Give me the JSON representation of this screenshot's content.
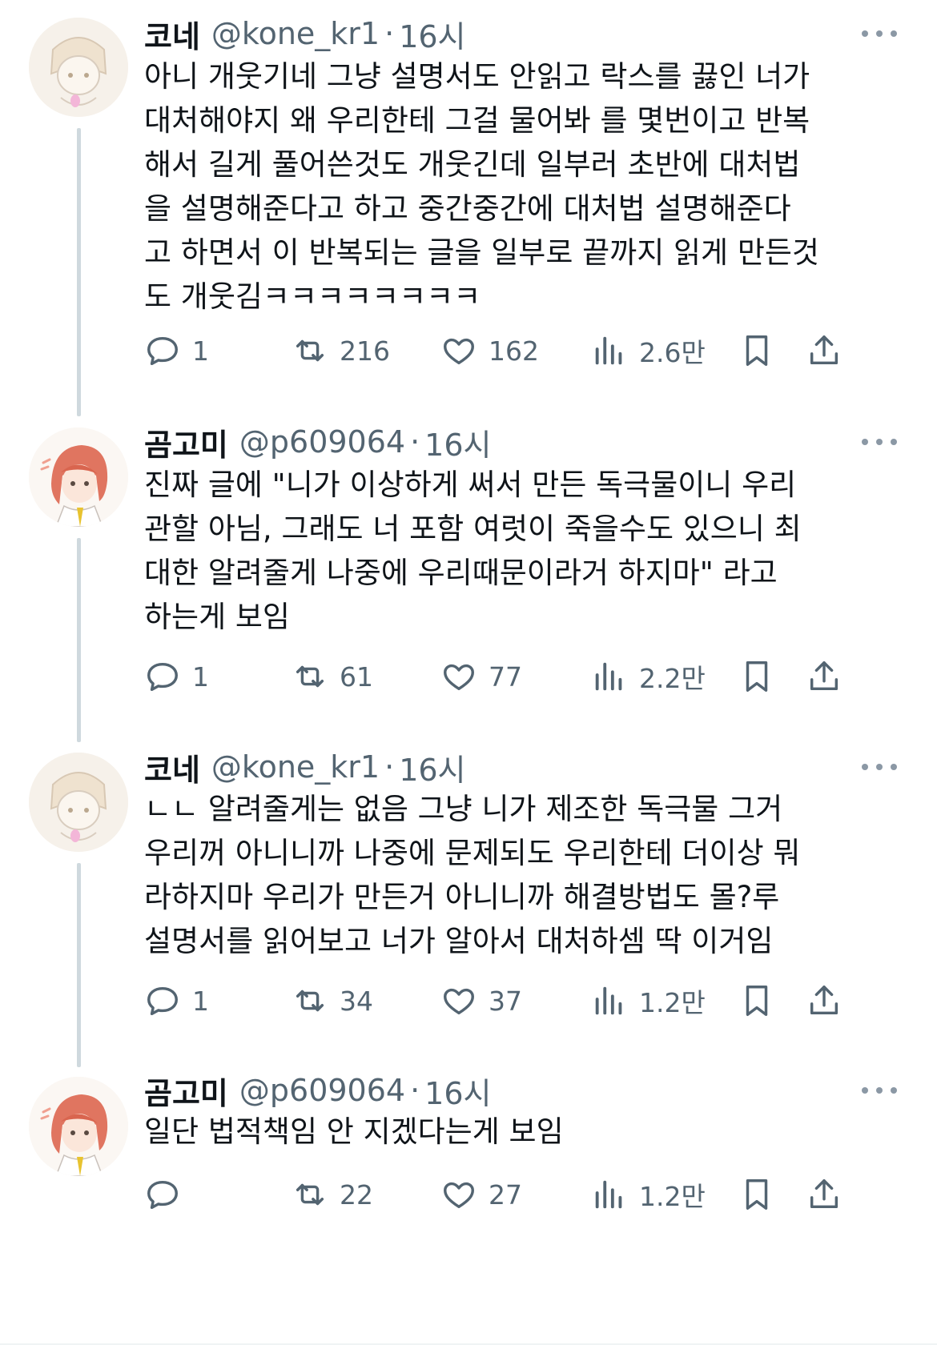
{
  "tweets": [
    {
      "name": "코네",
      "handle": "@kone_kr1",
      "time": "16시",
      "text": "아니 개웃기네 그냥 설명서도 안읽고 락스를 끓인 너가\n대처해야지 왜 우리한테 그걸 물어봐 를 몇번이고 반복\n해서 길게 풀어쓴것도 개웃긴데 일부러 초반에 대처법\n을 설명해준다고 하고 중간중간에 대처법 설명해준다\n고 하면서 이 반복되는 글을 일부로 끝까지 읽게 만든것\n도 개웃김ㅋㅋㅋㅋㅋㅋㅋㅋ",
      "replies": "1",
      "retweets": "216",
      "likes": "162",
      "views": "2.6만"
    },
    {
      "name": "곰고미",
      "handle": "@p609064",
      "time": "16시",
      "text": "진짜 글에 \"니가 이상하게 써서 만든 독극물이니 우리\n관할 아님, 그래도 너 포함 여럿이 죽을수도 있으니 최\n대한 알려줄게 나중에 우리때문이라거 하지마\" 라고\n하는게 보임",
      "replies": "1",
      "retweets": "61",
      "likes": "77",
      "views": "2.2만"
    },
    {
      "name": "코네",
      "handle": "@kone_kr1",
      "time": "16시",
      "text": "ㄴㄴ 알려줄게는 없음 그냥 니가 제조한 독극물 그거\n우리꺼 아니니까 나중에 문제되도 우리한테 더이상 뭐\n라하지마 우리가 만든거 아니니까 해결방법도 몰?루\n설명서를 읽어보고 너가 알아서 대처하셈 딱 이거임",
      "replies": "1",
      "retweets": "34",
      "likes": "37",
      "views": "1.2만"
    },
    {
      "name": "곰고미",
      "handle": "@p609064",
      "time": "16시",
      "text": "일단 법적책임 안 지겠다는게 보임",
      "replies": "",
      "retweets": "22",
      "likes": "27",
      "views": "1.2만"
    }
  ],
  "colors": {
    "text": "#0f1419",
    "secondary": "#536471",
    "thread_line": "#cfd9de"
  },
  "icons": [
    "reply-icon",
    "retweet-icon",
    "like-icon",
    "views-icon",
    "bookmark-icon",
    "share-icon",
    "more-icon"
  ]
}
